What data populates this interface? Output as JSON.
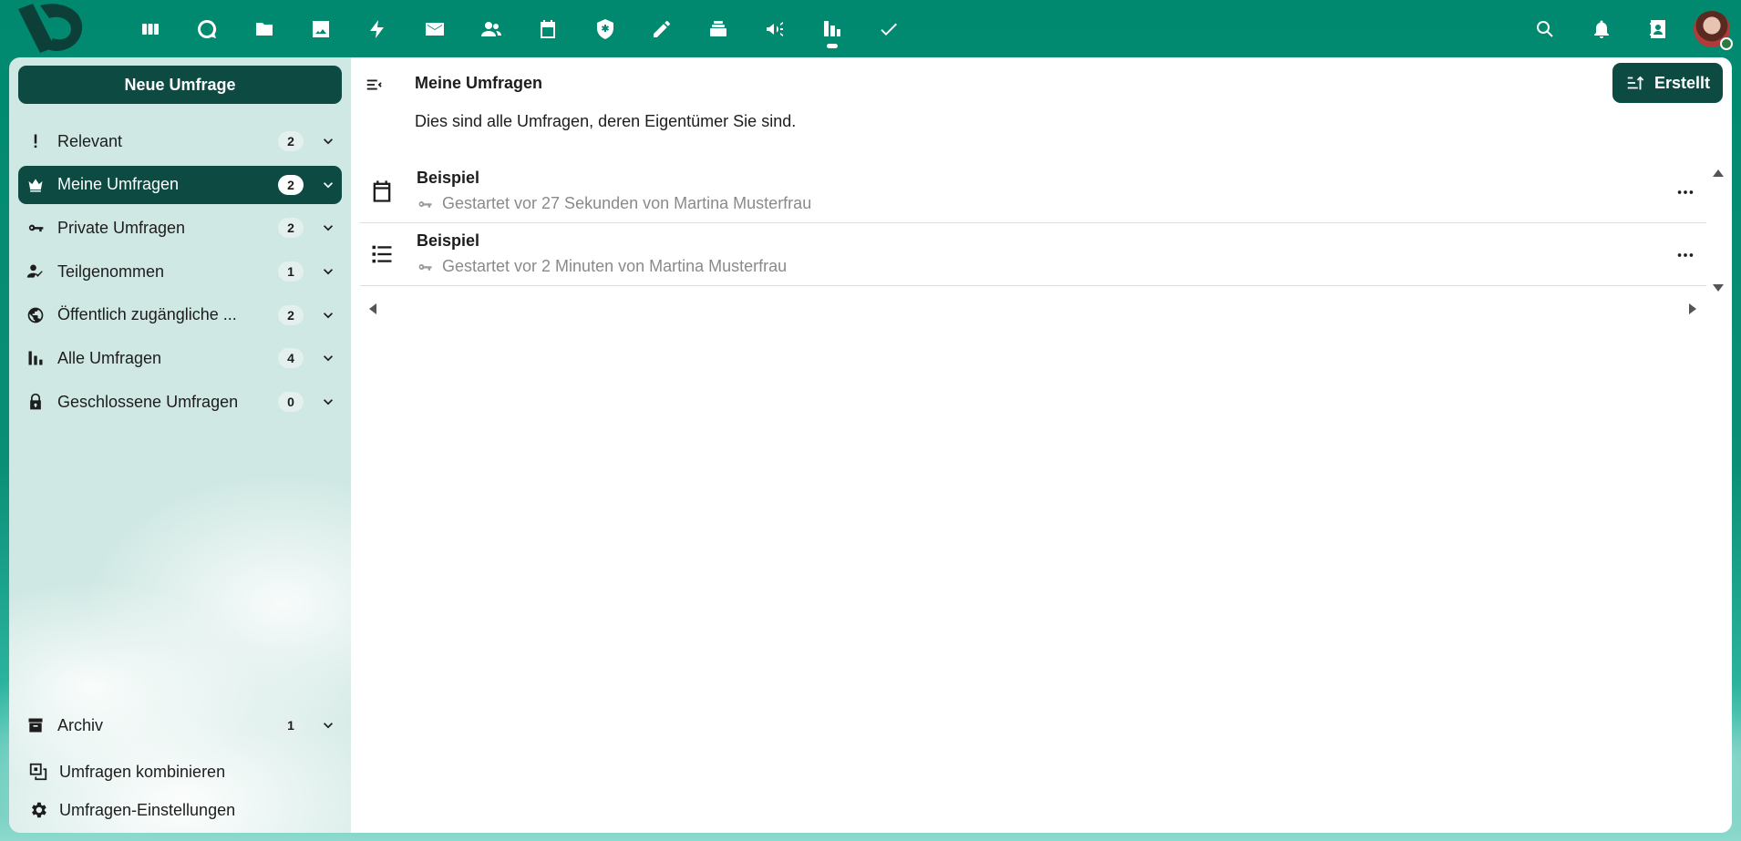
{
  "topbar": {
    "apps": [
      {
        "icon": "dashboard-icon",
        "active": false
      },
      {
        "icon": "talk-icon",
        "active": false
      },
      {
        "icon": "files-icon",
        "active": false
      },
      {
        "icon": "photos-icon",
        "active": false
      },
      {
        "icon": "activity-icon",
        "active": false
      },
      {
        "icon": "mail-icon",
        "active": false
      },
      {
        "icon": "contacts-icon",
        "active": false
      },
      {
        "icon": "calendar-icon",
        "active": false
      },
      {
        "icon": "passwords-icon",
        "active": false
      },
      {
        "icon": "notes-icon",
        "active": false
      },
      {
        "icon": "deck-icon",
        "active": false
      },
      {
        "icon": "announcements-icon",
        "active": false
      },
      {
        "icon": "polls-icon",
        "active": true
      },
      {
        "icon": "tasks-icon",
        "active": false
      }
    ],
    "right": [
      "search-icon",
      "notifications-icon",
      "contacts-menu-icon"
    ]
  },
  "sidebar": {
    "new_poll_label": "Neue Umfrage",
    "items": [
      {
        "label": "Relevant",
        "count": "2",
        "icon": "exclamation-icon",
        "active": false
      },
      {
        "label": "Meine Umfragen",
        "count": "2",
        "icon": "crown-icon",
        "active": true
      },
      {
        "label": "Private Umfragen",
        "count": "2",
        "icon": "key-icon",
        "active": false
      },
      {
        "label": "Teilgenommen",
        "count": "1",
        "icon": "account-check-icon",
        "active": false
      },
      {
        "label": "Öffentlich zugängliche ...",
        "count": "2",
        "icon": "globe-icon",
        "active": false
      },
      {
        "label": "Alle Umfragen",
        "count": "4",
        "icon": "bar-chart-icon",
        "active": false
      },
      {
        "label": "Geschlossene Umfragen",
        "count": "0",
        "icon": "lock-icon",
        "active": false
      }
    ],
    "archive": {
      "label": "Archiv",
      "count": "1",
      "icon": "archive-icon"
    },
    "combine_label": "Umfragen kombinieren",
    "settings_label": "Umfragen-Einstellungen"
  },
  "main": {
    "title": "Meine Umfragen",
    "description": "Dies sind alle Umfragen, deren Eigentümer Sie sind.",
    "sort_label": "Erstellt",
    "polls": [
      {
        "title": "Beispiel",
        "meta": "Gestartet vor 27 Sekunden von Martina Musterfrau",
        "type_icon": "calendar-icon"
      },
      {
        "title": "Beispiel",
        "meta": "Gestartet vor 2 Minuten von Martina Musterfrau",
        "type_icon": "text-list-icon"
      }
    ]
  },
  "colors": {
    "brand": "#00896f",
    "primary_dark": "#0c4a42",
    "sidebar_bg": "#cfe8e3"
  }
}
